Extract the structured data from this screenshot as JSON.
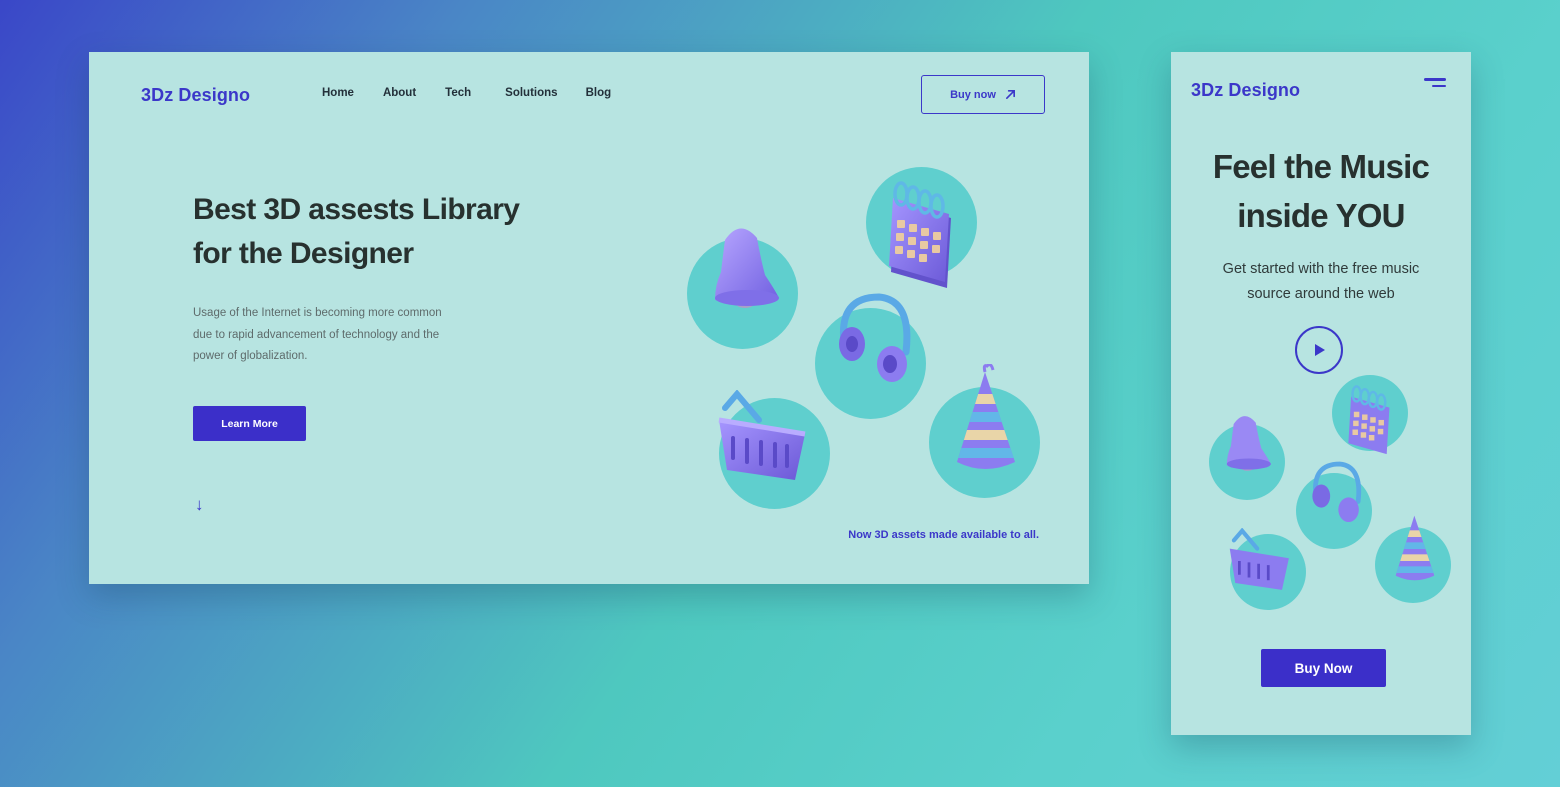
{
  "desktop": {
    "logo": "3Dz Designo",
    "nav": [
      "Home",
      "About",
      "Tech",
      "Solutions",
      "Blog"
    ],
    "buy_button": "Buy now",
    "hero_title": "Best 3D assests Library for the Designer",
    "hero_description": "Usage of the Internet is becoming more common due to rapid advancement of technology and the power of globalization.",
    "learn_more": "Learn More",
    "scroll_icon": "arrow-down-icon",
    "tagline": "Now 3D assets made available to all."
  },
  "mobile": {
    "logo": "3Dz Designo",
    "menu_icon": "hamburger-menu-icon",
    "title": "Feel the Music inside YOU",
    "description": "Get started with the free music source around the web",
    "play_icon": "play-icon",
    "buy_button": "Buy Now"
  },
  "illustrations": [
    "bell-icon",
    "calendar-icon",
    "headphones-icon",
    "shopping-basket-icon",
    "party-hat-icon"
  ],
  "colors": {
    "accent": "#3b37c9",
    "button": "#3b2fc9",
    "frame_bg": "#b7e4e1",
    "circle": "#5fcfce",
    "object": "#8c7cf0"
  }
}
